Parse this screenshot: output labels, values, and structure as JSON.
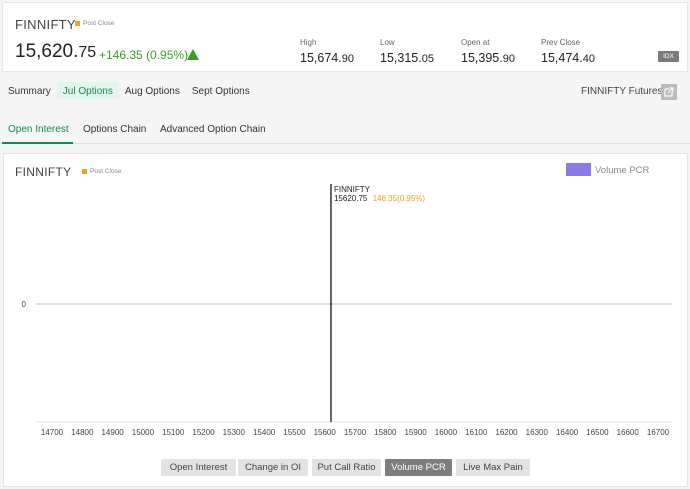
{
  "quote": {
    "name": "FINNIFTY",
    "status": "Post Close",
    "price_main": "15,620.",
    "price_dec": "75",
    "change": "+146.35 (0.95%)",
    "stats": [
      {
        "label": "High",
        "main": "15,674.",
        "dec": "90"
      },
      {
        "label": "Low",
        "main": "15,315.",
        "dec": "05"
      },
      {
        "label": "Open at",
        "main": "15,395.",
        "dec": "90"
      },
      {
        "label": "Prev Close",
        "main": "15,474.",
        "dec": "40"
      }
    ],
    "badge": "IDX"
  },
  "month_tabs": [
    "Summary",
    "Jul Options",
    "Aug Options",
    "Sept Options"
  ],
  "futures_link": "FINNIFTY Futures",
  "analysis_tabs": [
    "Open Interest",
    "Options Chain",
    "Advanced Option Chain"
  ],
  "chart_card": {
    "name": "FINNIFTY",
    "status": "Post Close",
    "legend": "Volume PCR",
    "marker_name": "FINNIFTY",
    "marker_price": "15620.75",
    "marker_change": "146.35(0.95%)"
  },
  "buttons": [
    "Open Interest",
    "Change in OI",
    "Put Call Ratio",
    "Volume PCR",
    "Live Max Pain"
  ],
  "colors": {
    "accent": "#138a55",
    "up": "#3a9d23",
    "series": "#8b7be8",
    "marker_change": "#f0a11e"
  },
  "chart_data": {
    "type": "line",
    "series": [
      {
        "name": "Volume PCR",
        "values": []
      }
    ],
    "x_ticks": [
      "14700",
      "14800",
      "14900",
      "15000",
      "15100",
      "15200",
      "15300",
      "15400",
      "15500",
      "15600",
      "15700",
      "15800",
      "15900",
      "16000",
      "16100",
      "16200",
      "16300",
      "16400",
      "16500",
      "16600",
      "16700"
    ],
    "y_ticks": [
      "0"
    ],
    "xlim": [
      14700,
      16700
    ],
    "marker_x": 15620.75,
    "legend_position": "top-right"
  }
}
